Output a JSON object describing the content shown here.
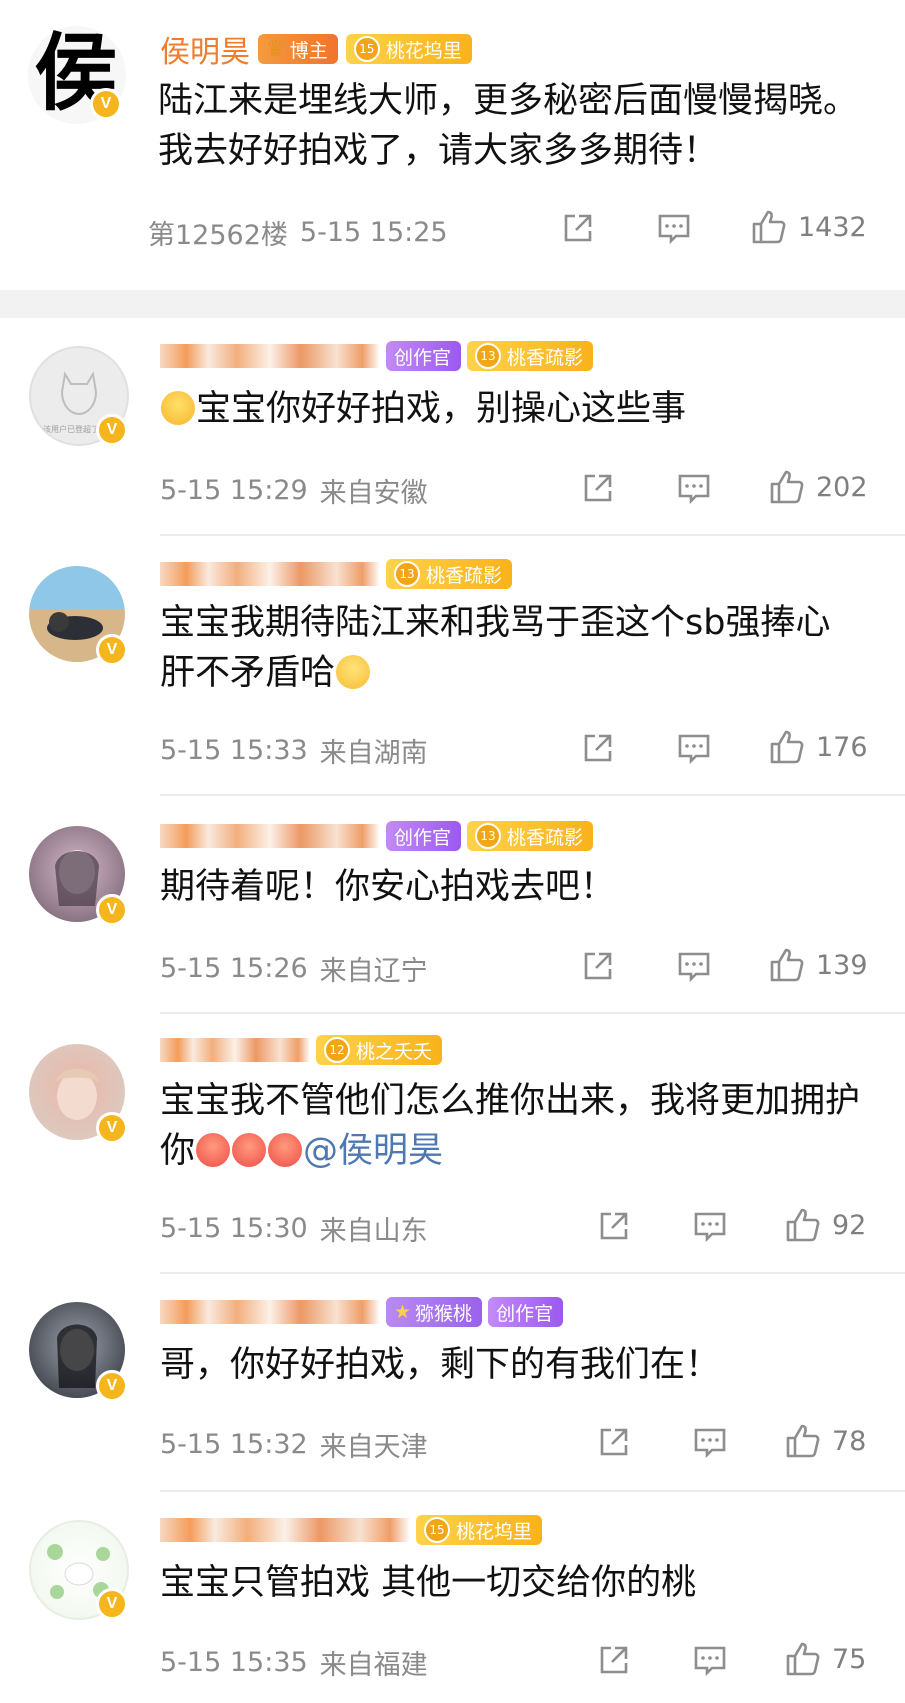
{
  "main_post": {
    "author": "侯明昊",
    "avatar_char": "侯",
    "tags": {
      "blogger": "博主",
      "level": "15",
      "fan_group": "桃花坞里"
    },
    "text": "陆江来是埋线大师，更多秘密后面慢慢揭晓。我去好好拍戏了，请大家多多期待！",
    "floor": "第12562楼",
    "time": "5-15 15:25",
    "likes": "1432"
  },
  "verified_mark": "V",
  "comments": [
    {
      "tags": {
        "creator": "创作官",
        "level": "13",
        "fan_group": "桃香疏影"
      },
      "text": "宝宝你好好拍戏，别操心这些事",
      "avatar_caption": "该用户已登超了中指",
      "time": "5-15 15:29",
      "location": "来自安徽",
      "likes": "202",
      "avatar_colors": [
        "#ececec",
        "#f6f6f6"
      ]
    },
    {
      "tags": {
        "level": "13",
        "fan_group": "桃香疏影"
      },
      "text": "宝宝我期待陆江来和我骂于歪这个sb强捧心肝不矛盾哈",
      "time": "5-15 15:33",
      "location": "来自湖南",
      "likes": "176",
      "avatar_colors": [
        "#8fc7e8",
        "#d7b68a"
      ]
    },
    {
      "tags": {
        "creator": "创作官",
        "level": "13",
        "fan_group": "桃香疏影"
      },
      "text": "期待着呢！你安心拍戏去吧！",
      "time": "5-15 15:26",
      "location": "来自辽宁",
      "likes": "139",
      "avatar_colors": [
        "#6d5b6a",
        "#d7b9c8"
      ]
    },
    {
      "tags": {
        "level": "12",
        "fan_group": "桃之夭夭"
      },
      "text": "宝宝我不管他们怎么推你出来，我将更加拥护你",
      "mention": "@侯明昊",
      "time": "5-15 15:30",
      "location": "来自山东",
      "likes": "92",
      "avatar_colors": [
        "#d9cfc8",
        "#e9b7a6"
      ]
    },
    {
      "tags": {
        "fan_group_badge": "猕猴桃",
        "creator": "创作官"
      },
      "text": "哥，你好好拍戏，剩下的有我们在！",
      "time": "5-15 15:32",
      "location": "来自天津",
      "likes": "78",
      "avatar_colors": [
        "#2a2c33",
        "#9aa2ad"
      ]
    },
    {
      "tags": {
        "level": "15",
        "fan_group": "桃花坞里"
      },
      "text": "宝宝只管拍戏 其他一切交给你的桃",
      "time": "5-15 15:35",
      "location": "来自福建",
      "likes": "75",
      "avatar_colors": [
        "#eef6ea",
        "#a9d79a"
      ]
    }
  ],
  "icons": {
    "repost": "repost-icon",
    "comment": "comment-icon",
    "like": "thumbs-up-icon"
  }
}
